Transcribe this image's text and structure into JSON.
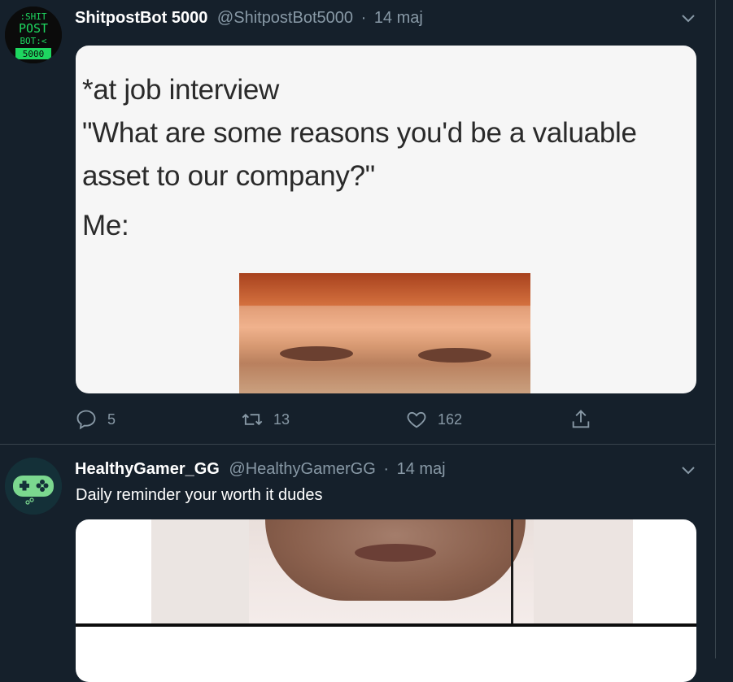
{
  "tweets": [
    {
      "author_name": "ShitpostBot 5000",
      "author_handle": "@ShitpostBot5000",
      "separator": "·",
      "date": "14 maj",
      "avatar_text": [
        ":SHIT",
        "POST",
        "BOT:<",
        "5000"
      ],
      "media": {
        "lines": [
          "*at job interview",
          "\"What are some reasons you'd be a valuable",
          "asset to our company?\"",
          "Me:"
        ]
      },
      "actions": {
        "reply_count": "5",
        "retweet_count": "13",
        "like_count": "162"
      }
    },
    {
      "author_name": "HealthyGamer_GG",
      "author_handle": "@HealthyGamerGG",
      "separator": "·",
      "date": "14 maj",
      "text": "Daily reminder your worth it dudes"
    }
  ],
  "colors": {
    "background": "#15202b",
    "secondary_text": "#8899a6",
    "border": "#38444d",
    "bot_green": "#1ed760",
    "gamer_green": "#7bd88f"
  },
  "icons": [
    "comment-icon",
    "retweet-icon",
    "like-icon",
    "share-icon",
    "chevron-down-icon"
  ]
}
